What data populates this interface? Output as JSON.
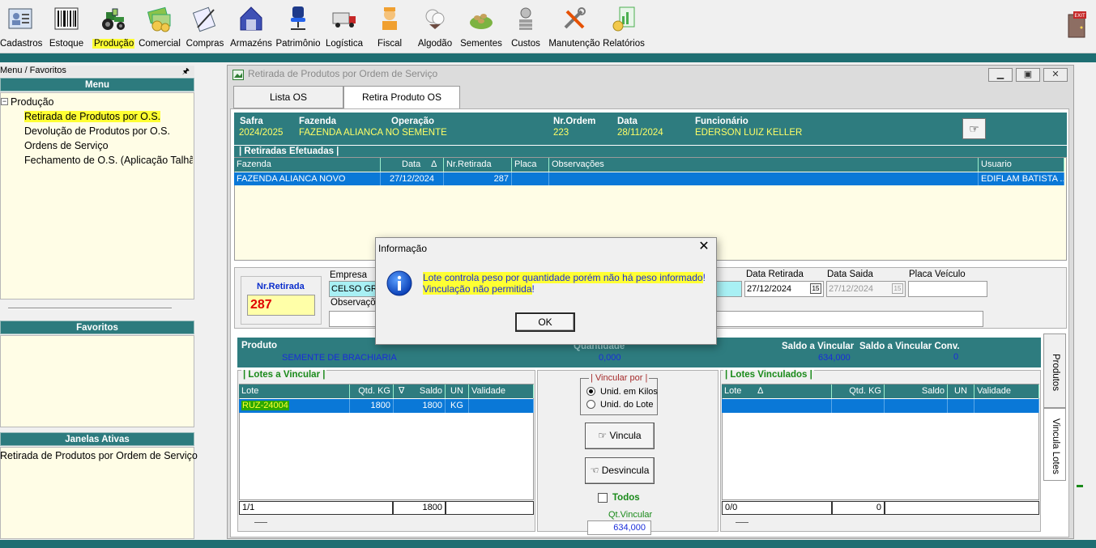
{
  "toolbar": {
    "items": [
      {
        "label": "Cadastros",
        "icon": "person-card-icon"
      },
      {
        "label": "Estoque",
        "icon": "barcode-icon"
      },
      {
        "label": "Produção",
        "icon": "tractor-icon"
      },
      {
        "label": "Comercial",
        "icon": "money-icon"
      },
      {
        "label": "Compras",
        "icon": "document-pen-icon"
      },
      {
        "label": "Armazéns",
        "icon": "warehouse-icon"
      },
      {
        "label": "Patrimônio",
        "icon": "chair-icon"
      },
      {
        "label": "Logística",
        "icon": "truck-icon"
      },
      {
        "label": "Fiscal",
        "icon": "officer-icon"
      },
      {
        "label": "Algodão",
        "icon": "cotton-icon"
      },
      {
        "label": "Sementes",
        "icon": "seeds-icon"
      },
      {
        "label": "Custos",
        "icon": "coins-icon"
      },
      {
        "label": "Manutenção",
        "icon": "tools-icon"
      },
      {
        "label": "Relatórios",
        "icon": "report-icon"
      }
    ],
    "exit_icon": "exit-door-icon"
  },
  "left_panel": {
    "title": "Menu / Favoritos",
    "menu_header": "Menu",
    "tree_root": "Produção",
    "tree_items": [
      "Retirada de Produtos por O.S.",
      "Devolução de Produtos por O.S.",
      "Ordens de Serviço",
      "Fechamento de O.S. (Aplicação Talhã"
    ],
    "favoritos_header": "Favoritos",
    "janelas_header": "Janelas Ativas",
    "janelas_items": [
      "Retirada de Produtos por Ordem de Serviço"
    ]
  },
  "window": {
    "title": "Retirada de Produtos por Ordem de Serviço",
    "tabs": [
      "Lista OS",
      "Retira Produto OS"
    ],
    "header": {
      "safra_label": "Safra",
      "safra": "2024/2025",
      "fazenda_label": "Fazenda",
      "fazenda": "FAZENDA ALIANCA NO SEMENTE",
      "operacao_label": "Operação",
      "nr_ordem_label": "Nr.Ordem",
      "nr_ordem": "223",
      "data_label": "Data",
      "data": "28/11/2024",
      "funcionario_label": "Funcionário",
      "funcionario": "EDERSON LUIZ KELLER"
    },
    "retiradas": {
      "title": "| Retiradas Efetuadas |",
      "columns": [
        "Fazenda",
        "Data",
        "Nr.Retirada",
        "Placa",
        "Observações",
        "Usuario"
      ],
      "sort_glyph": "∆",
      "row": [
        "FAZENDA ALIANCA NOVO",
        "27/12/2024",
        "287",
        "",
        "",
        "EDIFLAM BATISTA ..."
      ]
    },
    "form": {
      "nr_retirada_label": "Nr.Retirada",
      "nr_retirada": "287",
      "empresa_label": "Empresa",
      "empresa": "CELSO GR",
      "observacoes_label": "Observaçõ",
      "data_retirada_label": "Data Retirada",
      "data_retirada": "27/12/2024",
      "data_saida_label": "Data Saida",
      "data_saida": "27/12/2024",
      "placa_label": "Placa Veículo",
      "placa": "",
      "calendar_glyph": "15"
    },
    "produto": {
      "label": "Produto",
      "value": "SEMENTE DE BRACHIARIA",
      "quantidade_label": "Quantidade",
      "quantidade": "0,000",
      "saldo_label": "Saldo a Vincular",
      "saldo": "634,000",
      "saldo_conv_label": "Saldo a Vincular Conv.",
      "saldo_conv": "0"
    },
    "side_tabs": [
      "Produtos",
      "Vincula Lotes"
    ],
    "lotes_a_vincular": {
      "title": "| Lotes a Vincular |",
      "columns": [
        "Lote",
        "Qtd. KG",
        "Saldo",
        "UN",
        "Validade"
      ],
      "sort_glyph": "∇",
      "row": [
        "RUZ-24004",
        "1800",
        "1800",
        "KG",
        ""
      ],
      "footer_count": "1/1",
      "footer_total": "1800"
    },
    "vincular": {
      "group_title": "Vincular por",
      "options": [
        "Unid. em Kilos",
        "Unid. do Lote"
      ],
      "selected_index": 0,
      "vincula_label": "Vincula",
      "desvincula_label": "Desvincula",
      "todos_label": "Todos",
      "qt_vincular_label": "Qt.Vincular",
      "qt_vincular": "634,000"
    },
    "lotes_vinculados": {
      "title": "| Lotes Vinculados |",
      "columns": [
        "Lote",
        "Qtd. KG",
        "Saldo",
        "UN",
        "Validade"
      ],
      "sort_glyph": "∆",
      "footer_count": "0/0",
      "footer_total": "0"
    }
  },
  "dialog": {
    "title": "Informação",
    "message_line1": "Lote controla peso por quantidade porém não há peso informado",
    "message_line1_end": "!",
    "message_line2": "Vinculação não permitida",
    "message_line2_end": "!",
    "ok_label": "OK",
    "icon": "info-icon"
  },
  "colors": {
    "teal": "#2e7c7f",
    "selection": "#0a78d7",
    "highlight": "#ffff33",
    "header_value": "#ffff66"
  }
}
